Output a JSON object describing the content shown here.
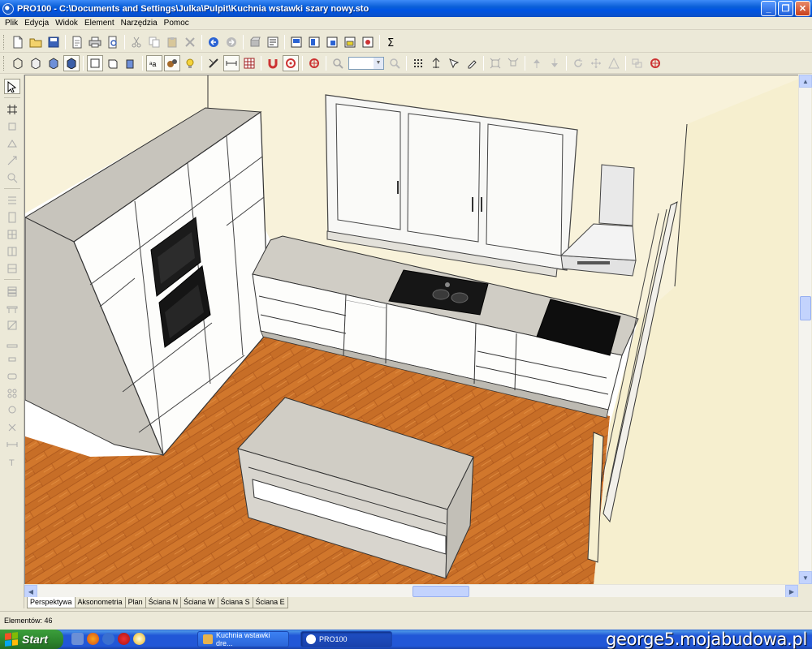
{
  "window": {
    "title": "PRO100 - C:\\Documents and Settings\\Julka\\Pulpit\\Kuchnia wstawki szary nowy.sto",
    "minimize": "_",
    "restore": "❐",
    "close": "✕"
  },
  "menu": [
    "Plik",
    "Edycja",
    "Widok",
    "Element",
    "Narzędzia",
    "Pomoc"
  ],
  "toolbar1": {
    "icons": [
      "new-file-icon",
      "open-folder-icon",
      "save-icon",
      "save-as-icon",
      "print-icon",
      "print-preview-icon",
      "cut-icon",
      "copy-icon",
      "paste-icon",
      "delete-icon",
      "undo-icon",
      "redo-icon",
      "library-icon",
      "properties-icon",
      "view-front-icon",
      "view-side-icon",
      "view-top-icon",
      "view-3d-icon",
      "report-icon",
      "sigma-icon"
    ]
  },
  "toolbar2": {
    "zoom_value": "",
    "icons": [
      "cube-wire-icon",
      "cube-flat-icon",
      "cube-shaded-icon",
      "cube-solid-icon",
      "box-outline-icon",
      "box-front-icon",
      "box-side-icon",
      "text-label-icon",
      "material-icon",
      "light-bulb-icon",
      "measure-icon",
      "dimension-icon",
      "grid-icon",
      "magnet-icon",
      "snap-target-icon",
      "center-target-icon",
      "zoom-icon"
    ]
  },
  "lefttools": {
    "icons": [
      "pointer-icon",
      "align-icon",
      "rotate-icon",
      "move-icon",
      "copy-tool-icon",
      "zoom-tool-icon",
      "wall-icon",
      "door-icon",
      "window-icon",
      "cabinet-icon",
      "shelf-icon",
      "drawer-icon",
      "countertop-icon",
      "panel-icon",
      "plinth-icon",
      "handle-icon",
      "sink-icon",
      "hob-icon",
      "light-icon",
      "accessory-icon",
      "measure-tool-icon",
      "text-tool-icon"
    ]
  },
  "tabs": [
    "Perspektywa",
    "Aksonometria",
    "Plan",
    "Ściana N",
    "Ściana W",
    "Ściana S",
    "Ściana E"
  ],
  "active_tab": "Perspektywa",
  "status": {
    "elements": "Elementów: 46"
  },
  "taskbar": {
    "start": "Start",
    "tasks": [
      "Kuchnia wstawki dre...",
      "PRO100"
    ],
    "watermark": "george5.mojabudowa.pl"
  }
}
